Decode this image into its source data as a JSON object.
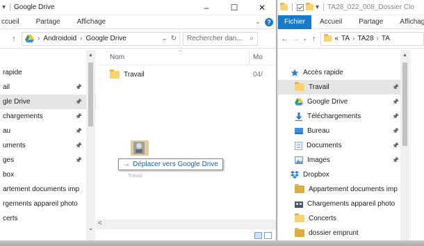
{
  "left_window": {
    "quick_access": {
      "dropdown_glyph": "▾"
    },
    "title": "Google Drive",
    "controls": {
      "minimize": "–",
      "maximize": "☐",
      "close": "✕"
    },
    "ribbon_tabs": [
      "ccueil",
      "Partage",
      "Affichage"
    ],
    "ribbon_expand": "⌄",
    "help": "?",
    "nav_buttons": {
      "up": "↑"
    },
    "address": {
      "segments": [
        "Androidoid",
        "Google Drive"
      ],
      "sep": "›",
      "dropdown": "⌄",
      "refresh": "↻"
    },
    "search": {
      "placeholder": "Rechercher dan...",
      "icon": "⌕"
    },
    "nav_items": [
      {
        "label": "rapide",
        "pin": ""
      },
      {
        "label": "ail",
        "pin": "📌"
      },
      {
        "label": "gle Drive",
        "pin": "📌",
        "selected": true
      },
      {
        "label": "chargements",
        "pin": "📌"
      },
      {
        "label": "au",
        "pin": "📌"
      },
      {
        "label": "uments",
        "pin": "📌"
      },
      {
        "label": "ges",
        "pin": "📌"
      },
      {
        "label": "box",
        "pin": ""
      },
      {
        "label": "artement documents imp",
        "pin": ""
      },
      {
        "label": "rgements appareil photo",
        "pin": ""
      },
      {
        "label": "certs",
        "pin": ""
      }
    ],
    "columns": {
      "name": "Nom",
      "modified": "Mo"
    },
    "sort_glyph": "^",
    "files": [
      {
        "name": "Travail",
        "modified": "04/"
      }
    ],
    "drag_tooltip": {
      "arrow": "→",
      "text": "Déplacer vers Google Drive"
    },
    "ghost_label": "Travail",
    "scroll": {
      "up": "▲",
      "down": "⌄",
      "left": "<"
    }
  },
  "right_window": {
    "title": "TA28_022_008_Dossier Clo",
    "quick_access_glyph": "▾",
    "ribbon_tabs": [
      "Fichier",
      "Accueil",
      "Partage",
      "Affichag"
    ],
    "nav_buttons": {
      "back": "←",
      "forward": "→",
      "recent": "⌄",
      "up": "↑"
    },
    "address": {
      "prefix": "«",
      "segments": [
        "TA",
        "TA28",
        "TA"
      ],
      "sep": "›"
    },
    "nav_items": [
      {
        "label": "Accès rapide",
        "icon": "star",
        "pin": ""
      },
      {
        "label": "Travail",
        "icon": "folder",
        "pin": "📌",
        "selected": true
      },
      {
        "label": "Google Drive",
        "icon": "gdrive",
        "pin": "📌"
      },
      {
        "label": "Téléchargements",
        "icon": "download",
        "pin": "📌"
      },
      {
        "label": "Bureau",
        "icon": "desktop",
        "pin": "📌"
      },
      {
        "label": "Documents",
        "icon": "document",
        "pin": "📌"
      },
      {
        "label": "Images",
        "icon": "images",
        "pin": "📌"
      },
      {
        "label": "Dropbox",
        "icon": "dropbox",
        "pin": ""
      },
      {
        "label": "Appartement documents imp",
        "icon": "folder-dark",
        "pin": ""
      },
      {
        "label": "Chargements appareil photo",
        "icon": "camera-folder",
        "pin": ""
      },
      {
        "label": "Concerts",
        "icon": "folder",
        "pin": ""
      },
      {
        "label": "dossier emprunt",
        "icon": "folder-dark",
        "pin": ""
      }
    ],
    "scroll_up": "▲"
  },
  "colors": {
    "accent": "#1979ca",
    "folder": "#f8d376",
    "selection": "#e5e5e5"
  }
}
